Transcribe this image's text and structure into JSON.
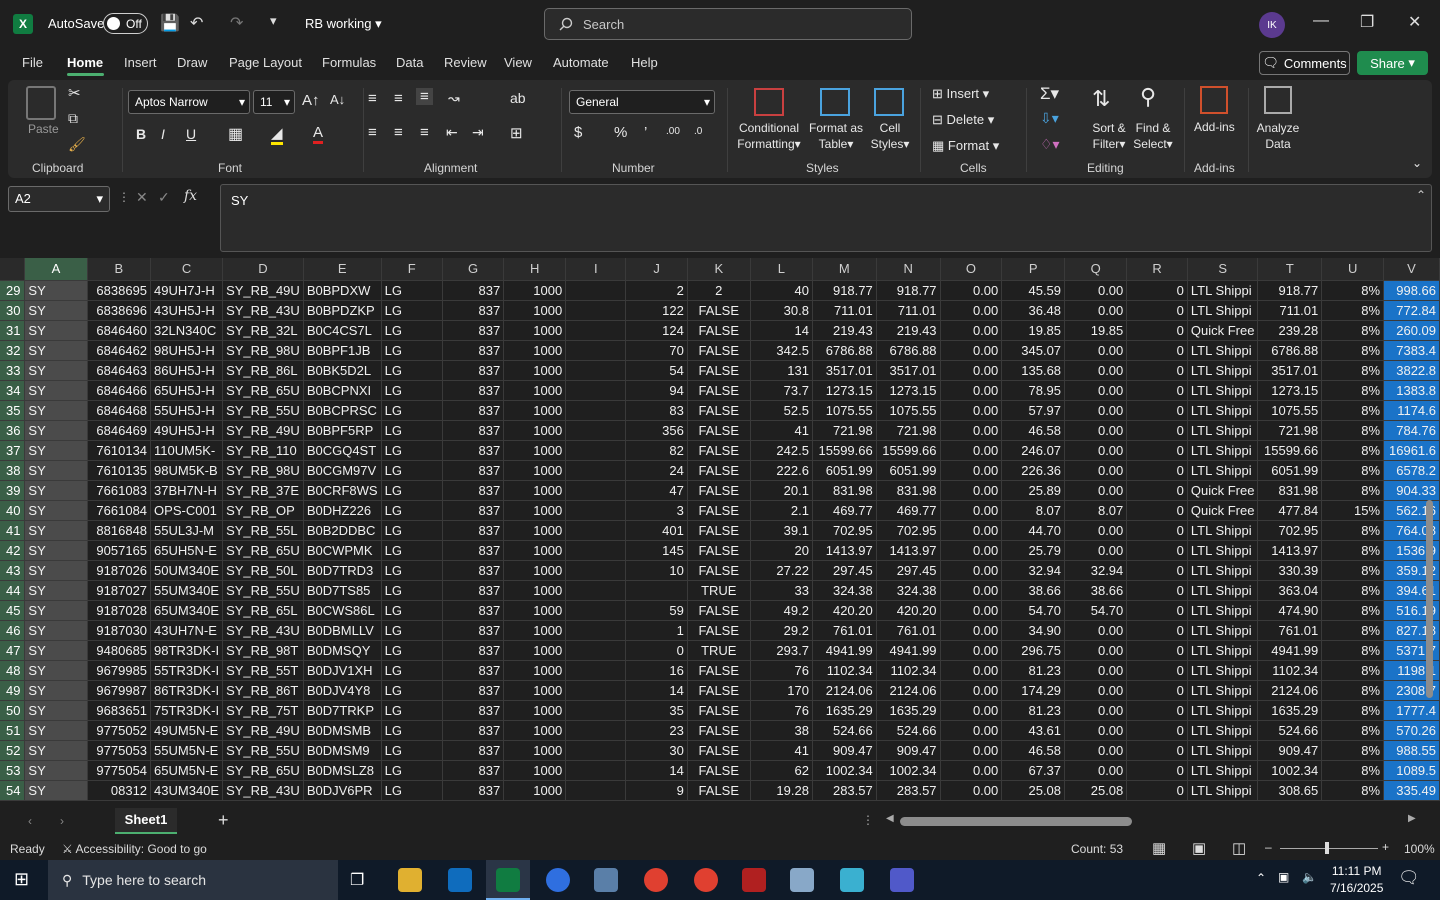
{
  "titlebar": {
    "autosave_label": "AutoSave",
    "autosave_state": "Off",
    "doc_name": "RB working",
    "search_placeholder": "Search",
    "user_initials": "IK"
  },
  "menu": [
    "File",
    "Home",
    "Insert",
    "Draw",
    "Page Layout",
    "Formulas",
    "Data",
    "Review",
    "View",
    "Automate",
    "Help"
  ],
  "menu_active": "Home",
  "comments_label": "Comments",
  "share_label": "Share",
  "ribbon": {
    "paste": "Paste",
    "clipboard": "Clipboard",
    "font_name": "Aptos Narrow",
    "font_size": "11",
    "font_group": "Font",
    "alignment_group": "Alignment",
    "number_format": "General",
    "number_group": "Number",
    "cond_format": [
      "Conditional",
      "Formatting"
    ],
    "format_table": [
      "Format as",
      "Table"
    ],
    "cell_styles": [
      "Cell",
      "Styles"
    ],
    "styles_group": "Styles",
    "insert": "Insert",
    "delete": "Delete",
    "format": "Format",
    "cells_group": "Cells",
    "sort_filter": [
      "Sort &",
      "Filter"
    ],
    "find_select": [
      "Find &",
      "Select"
    ],
    "editing_group": "Editing",
    "addins": "Add-ins",
    "addins_group": "Add-ins",
    "analyze": [
      "Analyze",
      "Data"
    ]
  },
  "formula": {
    "name_box": "A2",
    "content": "SY"
  },
  "columns": [
    "A",
    "B",
    "C",
    "D",
    "E",
    "F",
    "G",
    "H",
    "I",
    "J",
    "K",
    "L",
    "M",
    "N",
    "O",
    "P",
    "Q",
    "R",
    "S",
    "T",
    "U",
    "V"
  ],
  "rows": [
    {
      "n": "29",
      "c": [
        "SY",
        "6838695",
        "49UH7J-H",
        "SY_RB_49U",
        "B0BPDXW",
        "LG",
        "837",
        "1000",
        "",
        "2",
        "2",
        "40",
        "918.77",
        "918.77",
        "0.00",
        "45.59",
        "0.00",
        "0",
        "LTL Shippi",
        "918.77",
        "8%",
        "998.66"
      ]
    },
    {
      "n": "30",
      "c": [
        "SY",
        "6838696",
        "43UH5J-H",
        "SY_RB_43U",
        "B0BPDZKP",
        "LG",
        "837",
        "1000",
        "",
        "122",
        "FALSE",
        "30.8",
        "711.01",
        "711.01",
        "0.00",
        "36.48",
        "0.00",
        "0",
        "LTL Shippi",
        "711.01",
        "8%",
        "772.84"
      ]
    },
    {
      "n": "31",
      "c": [
        "SY",
        "6846460",
        "32LN340C",
        "SY_RB_32L",
        "B0C4CS7L",
        "LG",
        "837",
        "1000",
        "",
        "124",
        "FALSE",
        "14",
        "219.43",
        "219.43",
        "0.00",
        "19.85",
        "19.85",
        "0",
        "Quick Free",
        "239.28",
        "8%",
        "260.09"
      ]
    },
    {
      "n": "32",
      "c": [
        "SY",
        "6846462",
        "98UH5J-H",
        "SY_RB_98U",
        "B0BPF1JB",
        "LG",
        "837",
        "1000",
        "",
        "70",
        "FALSE",
        "342.5",
        "6786.88",
        "6786.88",
        "0.00",
        "345.07",
        "0.00",
        "0",
        "LTL Shippi",
        "6786.88",
        "8%",
        "7383.4"
      ]
    },
    {
      "n": "33",
      "c": [
        "SY",
        "6846463",
        "86UH5J-H",
        "SY_RB_86L",
        "B0BK5D2L",
        "LG",
        "837",
        "1000",
        "",
        "54",
        "FALSE",
        "131",
        "3517.01",
        "3517.01",
        "0.00",
        "135.68",
        "0.00",
        "0",
        "LTL Shippi",
        "3517.01",
        "8%",
        "3822.8"
      ]
    },
    {
      "n": "34",
      "c": [
        "SY",
        "6846466",
        "65UH5J-H",
        "SY_RB_65U",
        "B0BCPNXI",
        "LG",
        "837",
        "1000",
        "",
        "94",
        "FALSE",
        "73.7",
        "1273.15",
        "1273.15",
        "0.00",
        "78.95",
        "0.00",
        "0",
        "LTL Shippi",
        "1273.15",
        "8%",
        "1383.8"
      ]
    },
    {
      "n": "35",
      "c": [
        "SY",
        "6846468",
        "55UH5J-H",
        "SY_RB_55U",
        "B0BCPRSC",
        "LG",
        "837",
        "1000",
        "",
        "83",
        "FALSE",
        "52.5",
        "1075.55",
        "1075.55",
        "0.00",
        "57.97",
        "0.00",
        "0",
        "LTL Shippi",
        "1075.55",
        "8%",
        "1174.6"
      ]
    },
    {
      "n": "36",
      "c": [
        "SY",
        "6846469",
        "49UH5J-H",
        "SY_RB_49U",
        "B0BPF5RP",
        "LG",
        "837",
        "1000",
        "",
        "356",
        "FALSE",
        "41",
        "721.98",
        "721.98",
        "0.00",
        "46.58",
        "0.00",
        "0",
        "LTL Shippi",
        "721.98",
        "8%",
        "784.76"
      ]
    },
    {
      "n": "37",
      "c": [
        "SY",
        "7610134",
        "110UM5K-",
        "SY_RB_110",
        "B0CGQ4ST",
        "LG",
        "837",
        "1000",
        "",
        "82",
        "FALSE",
        "242.5",
        "15599.66",
        "15599.66",
        "0.00",
        "246.07",
        "0.00",
        "0",
        "LTL Shippi",
        "15599.66",
        "8%",
        "16961.6"
      ]
    },
    {
      "n": "38",
      "c": [
        "SY",
        "7610135",
        "98UM5K-B",
        "SY_RB_98U",
        "B0CGM97V",
        "LG",
        "837",
        "1000",
        "",
        "24",
        "FALSE",
        "222.6",
        "6051.99",
        "6051.99",
        "0.00",
        "226.36",
        "0.00",
        "0",
        "LTL Shippi",
        "6051.99",
        "8%",
        "6578.2"
      ]
    },
    {
      "n": "39",
      "c": [
        "SY",
        "7661083",
        "37BH7N-H",
        "SY_RB_37E",
        "B0CRF8WS",
        "LG",
        "837",
        "1000",
        "",
        "47",
        "FALSE",
        "20.1",
        "831.98",
        "831.98",
        "0.00",
        "25.89",
        "0.00",
        "0",
        "Quick Free",
        "831.98",
        "8%",
        "904.33"
      ]
    },
    {
      "n": "40",
      "c": [
        "SY",
        "7661084",
        "OPS-C001",
        "SY_RB_OP",
        "B0DHZ226",
        "LG",
        "837",
        "1000",
        "",
        "3",
        "FALSE",
        "2.1",
        "469.77",
        "469.77",
        "0.00",
        "8.07",
        "8.07",
        "0",
        "Quick Free",
        "477.84",
        "15%",
        "562.16"
      ]
    },
    {
      "n": "41",
      "c": [
        "SY",
        "8816848",
        "55UL3J-M",
        "SY_RB_55L",
        "B0B2DDBC",
        "LG",
        "837",
        "1000",
        "",
        "401",
        "FALSE",
        "39.1",
        "702.95",
        "702.95",
        "0.00",
        "44.70",
        "0.00",
        "0",
        "LTL Shippi",
        "702.95",
        "8%",
        "764.08"
      ]
    },
    {
      "n": "42",
      "c": [
        "SY",
        "9057165",
        "65UH5N-E",
        "SY_RB_65U",
        "B0CWPMK",
        "LG",
        "837",
        "1000",
        "",
        "145",
        "FALSE",
        "20",
        "1413.97",
        "1413.97",
        "0.00",
        "25.79",
        "0.00",
        "0",
        "LTL Shippi",
        "1413.97",
        "8%",
        "1536.9"
      ]
    },
    {
      "n": "43",
      "c": [
        "SY",
        "9187026",
        "50UM340E",
        "SY_RB_50L",
        "B0D7TRD3",
        "LG",
        "837",
        "1000",
        "",
        "10",
        "FALSE",
        "27.22",
        "297.45",
        "297.45",
        "0.00",
        "32.94",
        "32.94",
        "0",
        "LTL Shippi",
        "330.39",
        "8%",
        "359.12"
      ]
    },
    {
      "n": "44",
      "c": [
        "SY",
        "9187027",
        "55UM340E",
        "SY_RB_55U",
        "B0D7TS85",
        "LG",
        "837",
        "1000",
        "",
        "",
        "TRUE",
        "33",
        "324.38",
        "324.38",
        "0.00",
        "38.66",
        "38.66",
        "0",
        "LTL Shippi",
        "363.04",
        "8%",
        "394.61"
      ]
    },
    {
      "n": "45",
      "c": [
        "SY",
        "9187028",
        "65UM340E",
        "SY_RB_65L",
        "B0CWS86L",
        "LG",
        "837",
        "1000",
        "",
        "59",
        "FALSE",
        "49.2",
        "420.20",
        "420.20",
        "0.00",
        "54.70",
        "54.70",
        "0",
        "LTL Shippi",
        "474.90",
        "8%",
        "516.19"
      ]
    },
    {
      "n": "46",
      "c": [
        "SY",
        "9187030",
        "43UH7N-E",
        "SY_RB_43U",
        "B0DBMLLV",
        "LG",
        "837",
        "1000",
        "",
        "1",
        "FALSE",
        "29.2",
        "761.01",
        "761.01",
        "0.00",
        "34.90",
        "0.00",
        "0",
        "LTL Shippi",
        "761.01",
        "8%",
        "827.18"
      ]
    },
    {
      "n": "47",
      "c": [
        "SY",
        "9480685",
        "98TR3DK-I",
        "SY_RB_98T",
        "B0DMSQY",
        "LG",
        "837",
        "1000",
        "",
        "0",
        "TRUE",
        "293.7",
        "4941.99",
        "4941.99",
        "0.00",
        "296.75",
        "0.00",
        "0",
        "LTL Shippi",
        "4941.99",
        "8%",
        "5371.7"
      ]
    },
    {
      "n": "48",
      "c": [
        "SY",
        "9679985",
        "55TR3DK-I",
        "SY_RB_55T",
        "B0DJV1XH",
        "LG",
        "837",
        "1000",
        "",
        "16",
        "FALSE",
        "76",
        "1102.34",
        "1102.34",
        "0.00",
        "81.23",
        "0.00",
        "0",
        "LTL Shippi",
        "1102.34",
        "8%",
        "1198.1"
      ]
    },
    {
      "n": "49",
      "c": [
        "SY",
        "9679987",
        "86TR3DK-I",
        "SY_RB_86T",
        "B0DJV4Y8",
        "LG",
        "837",
        "1000",
        "",
        "14",
        "FALSE",
        "170",
        "2124.06",
        "2124.06",
        "0.00",
        "174.29",
        "0.00",
        "0",
        "LTL Shippi",
        "2124.06",
        "8%",
        "2308.7"
      ]
    },
    {
      "n": "50",
      "c": [
        "SY",
        "9683651",
        "75TR3DK-I",
        "SY_RB_75T",
        "B0D7TRKP",
        "LG",
        "837",
        "1000",
        "",
        "35",
        "FALSE",
        "76",
        "1635.29",
        "1635.29",
        "0.00",
        "81.23",
        "0.00",
        "0",
        "LTL Shippi",
        "1635.29",
        "8%",
        "1777.4"
      ]
    },
    {
      "n": "51",
      "c": [
        "SY",
        "9775052",
        "49UM5N-E",
        "SY_RB_49U",
        "B0DMSMB",
        "LG",
        "837",
        "1000",
        "",
        "23",
        "FALSE",
        "38",
        "524.66",
        "524.66",
        "0.00",
        "43.61",
        "0.00",
        "0",
        "LTL Shippi",
        "524.66",
        "8%",
        "570.26"
      ]
    },
    {
      "n": "52",
      "c": [
        "SY",
        "9775053",
        "55UM5N-E",
        "SY_RB_55U",
        "B0DMSM9",
        "LG",
        "837",
        "1000",
        "",
        "30",
        "FALSE",
        "41",
        "909.47",
        "909.47",
        "0.00",
        "46.58",
        "0.00",
        "0",
        "LTL Shippi",
        "909.47",
        "8%",
        "988.55"
      ]
    },
    {
      "n": "53",
      "c": [
        "SY",
        "9775054",
        "65UM5N-E",
        "SY_RB_65U",
        "B0DMSLZ8",
        "LG",
        "837",
        "1000",
        "",
        "14",
        "FALSE",
        "62",
        "1002.34",
        "1002.34",
        "0.00",
        "67.37",
        "0.00",
        "0",
        "LTL Shippi",
        "1002.34",
        "8%",
        "1089.5"
      ]
    },
    {
      "n": "54",
      "c": [
        "SY",
        "08312",
        "43UM340E",
        "SY_RB_43U",
        "B0DJV6PR",
        "LG",
        "837",
        "1000",
        "",
        "9",
        "FALSE",
        "19.28",
        "283.57",
        "283.57",
        "0.00",
        "25.08",
        "25.08",
        "0",
        "LTL Shippi",
        "308.65",
        "8%",
        "335.49"
      ]
    }
  ],
  "sheet_tab": "Sheet1",
  "status": {
    "ready": "Ready",
    "accessibility": "Accessibility: Good to go",
    "count": "Count: 53",
    "zoom": "100%"
  },
  "taskbar": {
    "search_placeholder": "Type here to search",
    "time": "11:11 PM",
    "date": "7/16/2025"
  },
  "colors": {
    "accent_green": "#107c41",
    "selection": "#1a73c8",
    "share": "#1f8c4e"
  }
}
